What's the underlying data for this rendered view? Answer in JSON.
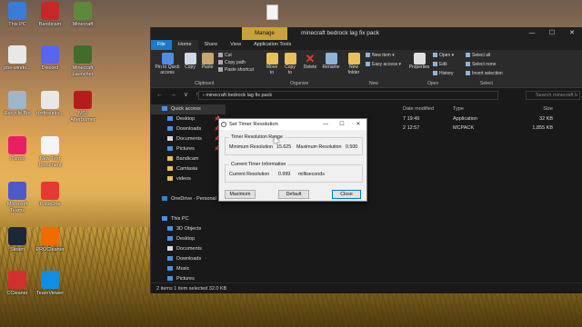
{
  "desktop": {
    "icons": [
      {
        "label": "This PC",
        "icon": "computer-icon",
        "color": "#3a7bd5"
      },
      {
        "label": "Bandicam",
        "icon": "bandicam-icon",
        "color": "#c62828"
      },
      {
        "label": "Minecraft",
        "icon": "minecraft-icon",
        "color": "#5d8a3a"
      },
      {
        "label": "pbs-windo...",
        "icon": "file-icon",
        "color": "#e8e8e8"
      },
      {
        "label": "Discord",
        "icon": "discord-icon",
        "color": "#5865f2"
      },
      {
        "label": "Minecraft Launcher",
        "icon": "minecraft-launcher-icon",
        "color": "#3f6e2c"
      },
      {
        "label": "Recycle Bin",
        "icon": "recycle-bin-icon",
        "color": "#9fb6c8"
      },
      {
        "label": "dxrfpsunlo...",
        "icon": "file-icon",
        "color": "#e8e8e8"
      },
      {
        "label": "MSI Afterburner",
        "icon": "msi-afterburner-icon",
        "color": "#b71c1c"
      },
      {
        "label": "iTunes",
        "icon": "itunes-icon",
        "color": "#e91e63"
      },
      {
        "label": "New Text Document",
        "icon": "text-document-icon",
        "color": "#f5f5f5"
      },
      {
        "label": "Microsoft Teams",
        "icon": "teams-icon",
        "color": "#5059c9"
      },
      {
        "label": "PokeOne",
        "icon": "pokeball-icon",
        "color": "#e53935"
      },
      {
        "label": "Steam",
        "icon": "steam-icon",
        "color": "#1b2838"
      },
      {
        "label": "PROCleaner",
        "icon": "procleaner-icon",
        "color": "#ef6c00"
      },
      {
        "label": "CCleaner",
        "icon": "ccleaner-icon",
        "color": "#d32f2f"
      },
      {
        "label": "TeamViewer",
        "icon": "teamviewer-icon",
        "color": "#0e8ee9"
      }
    ]
  },
  "explorer": {
    "manage_tab": "Manage",
    "title": "minecraft bedrock lag fix pack",
    "controls": {
      "minimize": "—",
      "maximize": "☐",
      "close": "✕"
    },
    "tabs": [
      "File",
      "Home",
      "Share",
      "View",
      "Application Tools"
    ],
    "ribbon": {
      "pin": "Pin to Quick access",
      "copy": "Copy",
      "paste": "Paste",
      "cut": "Cut",
      "copy_path": "Copy path",
      "paste_shortcut": "Paste shortcut",
      "clipboard_group": "Clipboard",
      "move_to": "Move to",
      "copy_to": "Copy to",
      "delete": "Delete",
      "rename": "Rename",
      "organize_group": "Organize",
      "new_folder": "New folder",
      "new_item": "New item",
      "easy_access": "Easy access",
      "new_group": "New",
      "properties": "Properties",
      "open": "Open",
      "edit": "Edit",
      "history": "History",
      "open_group": "Open",
      "select_all": "Select all",
      "select_none": "Select none",
      "invert_selection": "Invert selection",
      "select_group": "Select"
    },
    "address": {
      "nav": "← → ∨ ↑",
      "path": "› minecraft bedrock lag fix pack",
      "search_placeholder": "Search minecraft b"
    },
    "nav_pane": [
      {
        "label": "Quick access",
        "pinned": false,
        "sub": false,
        "color": "#4a90e2"
      },
      {
        "label": "Desktop",
        "pinned": true,
        "sub": true,
        "color": "#4a90e2"
      },
      {
        "label": "Downloads",
        "pinned": true,
        "sub": true,
        "color": "#4a90e2"
      },
      {
        "label": "Documents",
        "pinned": true,
        "sub": true,
        "color": "#d9d9d9"
      },
      {
        "label": "Pictures",
        "pinned": true,
        "sub": true,
        "color": "#4a90e2"
      },
      {
        "label": "Bandicam",
        "pinned": false,
        "sub": true,
        "color": "#e8c15a"
      },
      {
        "label": "Camtasia",
        "pinned": false,
        "sub": true,
        "color": "#e8c15a"
      },
      {
        "label": "videos",
        "pinned": false,
        "sub": true,
        "color": "#e8c15a"
      },
      {
        "label": "",
        "pinned": false,
        "sub": false,
        "color": ""
      },
      {
        "label": "OneDrive - Personal",
        "pinned": false,
        "sub": false,
        "color": "#2b88d8"
      },
      {
        "label": "",
        "pinned": false,
        "sub": false,
        "color": ""
      },
      {
        "label": "This PC",
        "pinned": false,
        "sub": false,
        "color": "#4a90e2"
      },
      {
        "label": "3D Objects",
        "pinned": false,
        "sub": true,
        "color": "#4a90e2"
      },
      {
        "label": "Desktop",
        "pinned": false,
        "sub": true,
        "color": "#4a90e2"
      },
      {
        "label": "Documents",
        "pinned": false,
        "sub": true,
        "color": "#d9d9d9"
      },
      {
        "label": "Downloads",
        "pinned": false,
        "sub": true,
        "color": "#4a90e2"
      },
      {
        "label": "Music",
        "pinned": false,
        "sub": true,
        "color": "#4a90e2"
      },
      {
        "label": "Pictures",
        "pinned": false,
        "sub": true,
        "color": "#4a90e2"
      }
    ],
    "columns": {
      "name": "",
      "date": "Date modified",
      "type": "Type",
      "size": "Size"
    },
    "files": [
      {
        "name": "",
        "date": "7 19:49",
        "type": "Application",
        "size": "32 KB"
      },
      {
        "name": "",
        "date": "2 12:57",
        "type": "MCPACK",
        "size": "1,855 KB"
      }
    ],
    "status": "2 items    1 item selected 32.0 KB"
  },
  "dialog": {
    "title": "Set Timer Resolution",
    "controls": {
      "minimize": "—",
      "maximize": "☐",
      "close": "✕"
    },
    "range_group": "Timer Resolution Range",
    "min_label": "Minimum Resolution",
    "min_value": "15.625",
    "max_label": "Maximum Resolution",
    "max_value": "0.500",
    "current_group": "Current Timer Information",
    "current_label": "Current Resolution",
    "current_value": "0.999",
    "current_unit": "milliseconds",
    "buttons": {
      "maximum": "Maximum",
      "default": "Default",
      "close": "Close"
    }
  }
}
